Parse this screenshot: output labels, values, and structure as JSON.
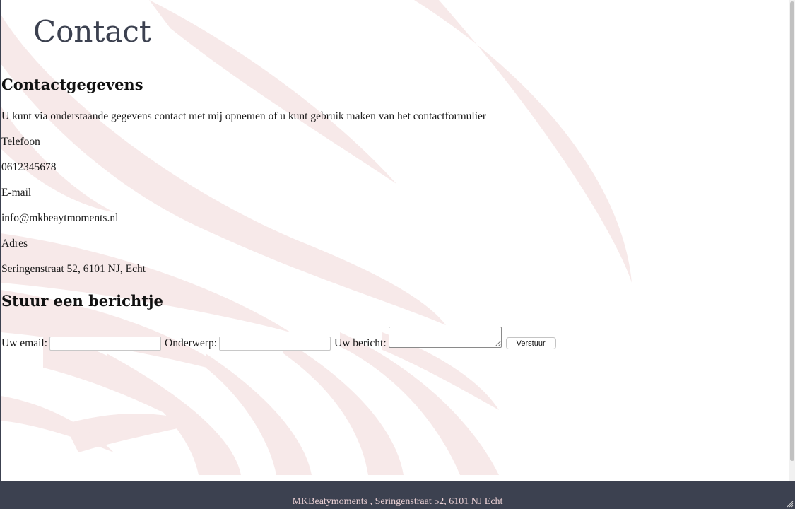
{
  "page": {
    "title": "Contact"
  },
  "contact": {
    "heading": "Contactgegevens",
    "intro": "U kunt via onderstaande gegevens contact met mij opnemen of u kunt gebruik maken van het contactformulier",
    "phone_label": "Telefoon",
    "phone_value": "0612345678",
    "email_label": "E-mail",
    "email_value": "info@mkbeaytmoments.nl",
    "address_label": "Adres",
    "address_value": "Seringenstraat 52, 6101 NJ, Echt"
  },
  "form": {
    "heading": "Stuur een berichtje",
    "email_label": "Uw email:",
    "email_value": "",
    "subject_label": "Onderwerp:",
    "subject_value": "",
    "message_label": "Uw bericht:",
    "message_value": "",
    "submit_label": "Verstuur"
  },
  "footer": {
    "text": "MKBeatymoments , Seringenstraat 52, 6101 NJ Echt"
  },
  "colors": {
    "title": "#3c4150",
    "footer_bg": "#3c4150",
    "footer_text": "#e9cfd3",
    "watermark": "#f7e9e9"
  }
}
